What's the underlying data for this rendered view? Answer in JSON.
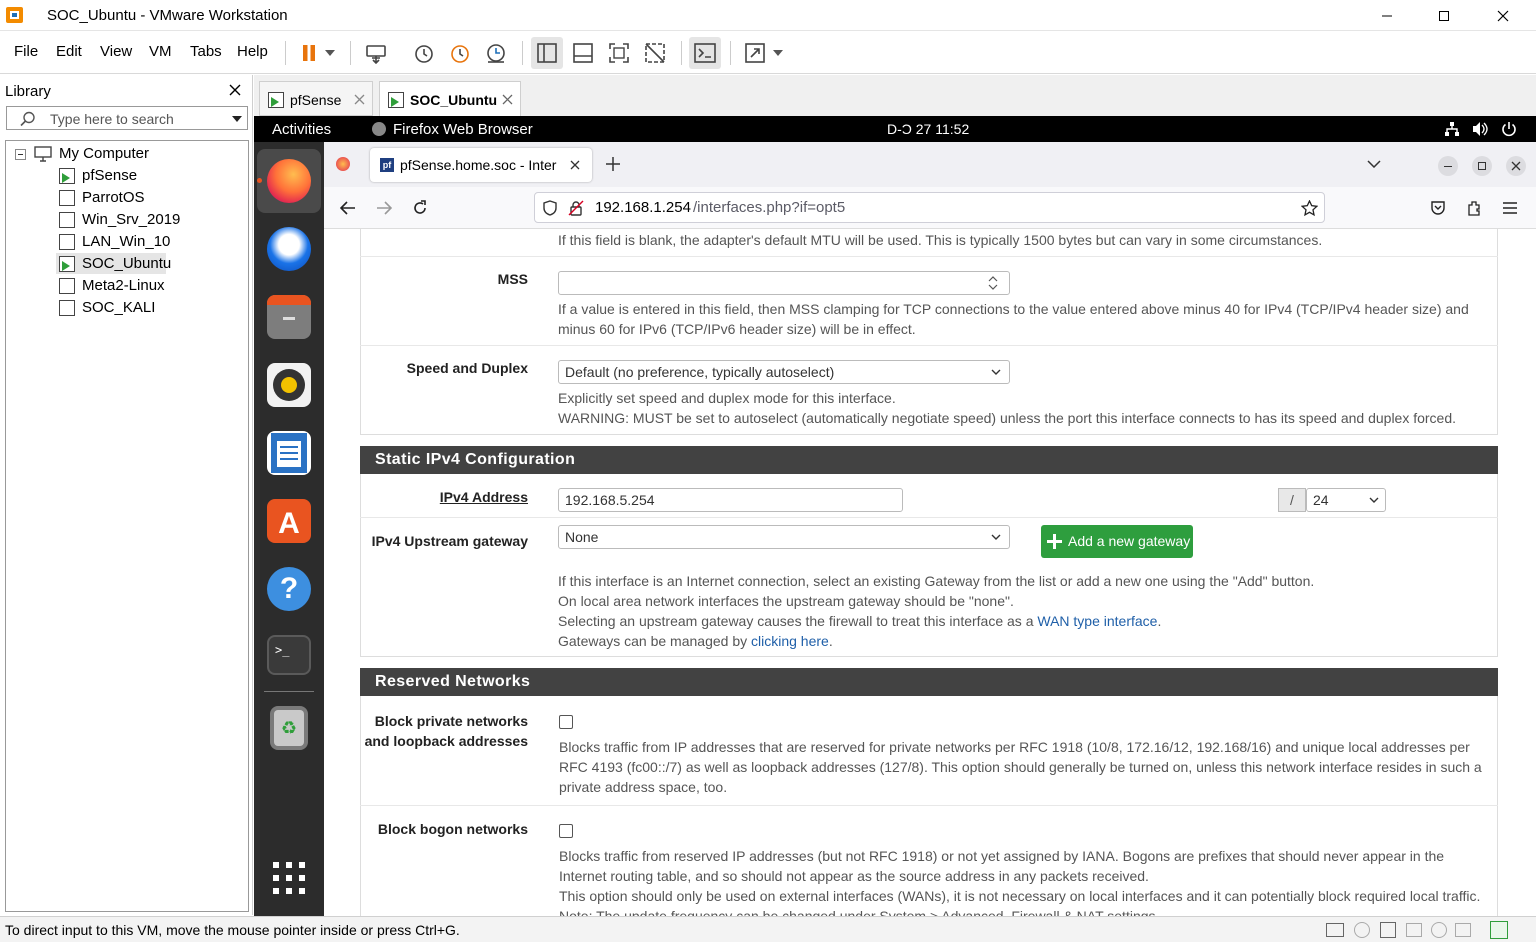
{
  "window": {
    "title": "SOC_Ubuntu - VMware Workstation"
  },
  "menu": [
    "File",
    "Edit",
    "View",
    "VM",
    "Tabs",
    "Help"
  ],
  "library": {
    "title": "Library",
    "search_placeholder": "Type here to search",
    "root": "My Computer",
    "vms": [
      "pfSense",
      "ParrotOS",
      "Win_Srv_2019",
      "LAN_Win_10",
      "SOC_Ubuntu",
      "Meta2-Linux",
      "SOC_KALI"
    ]
  },
  "vm_tabs": [
    "pfSense",
    "SOC_Ubuntu"
  ],
  "gnome": {
    "activities": "Activities",
    "app": "Firefox Web Browser",
    "clock": "D-Ͻ 27  11:52"
  },
  "firefox": {
    "tab_title": "pfSense.home.soc - Inter",
    "url_host": "192.168.1.254",
    "url_path": "/interfaces.php?if=opt5"
  },
  "page": {
    "mtu_help": "If this field is blank, the adapter's default MTU will be used. This is typically 1500 bytes but can vary in some circumstances.",
    "mss_label": "MSS",
    "mss_help": "If a value is entered in this field, then MSS clamping for TCP connections to the value entered above minus 40 for IPv4 (TCP/IPv4 header size) and minus 60 for IPv6 (TCP/IPv6 header size) will be in effect.",
    "speed_label": "Speed and Duplex",
    "speed_value": "Default (no preference, typically autoselect)",
    "speed_help_1": "Explicitly set speed and duplex mode for this interface.",
    "speed_help_2": "WARNING: MUST be set to autoselect (automatically negotiate speed) unless the port this interface connects to has its speed and duplex forced.",
    "static_section": "Static IPv4 Configuration",
    "ipv4_label": "IPv4 Address",
    "ipv4_value": "192.168.5.254",
    "slash": "/",
    "cidr": "24",
    "gw_label": "IPv4 Upstream gateway",
    "gw_value": "None",
    "add_gw": "Add a new gateway",
    "gw_help_1": "If this interface is an Internet connection, select an existing Gateway from the list or add a new one using the \"Add\" button.",
    "gw_help_2": "On local area network interfaces the upstream gateway should be \"none\".",
    "gw_help_3a": "Selecting an upstream gateway causes the firewall to treat this interface as a ",
    "gw_help_3_link": "WAN type interface",
    "gw_help_3b": ".",
    "gw_help_4a": "Gateways can be managed by ",
    "gw_help_4_link": "clicking here",
    "gw_help_4b": ".",
    "reserved_section": "Reserved Networks",
    "block_private_label_1": "Block private networks",
    "block_private_label_2": "and loopback addresses",
    "block_private_help": "Blocks traffic from IP addresses that are reserved for private networks per RFC 1918 (10/8, 172.16/12, 192.168/16) and unique local addresses per RFC 4193 (fc00::/7) as well as loopback addresses (127/8). This option should generally be turned on, unless this network interface resides in such a private address space, too.",
    "block_bogon_label": "Block bogon networks",
    "block_bogon_help_1": "Blocks traffic from reserved IP addresses (but not RFC 1918) or not yet assigned by IANA. Bogons are prefixes that should never appear in the Internet routing table, and so should not appear as the source address in any packets received.",
    "block_bogon_help_2": "This option should only be used on external interfaces (WANs), it is not necessary on local interfaces and it can potentially block required local traffic.",
    "block_bogon_help_3": "Note: The update frequency can be changed under System > Advanced, Firewall & NAT settings."
  },
  "status": {
    "text": "To direct input to this VM, move the mouse pointer inside or press Ctrl+G."
  },
  "colors": {
    "section_bg": "#424242",
    "green_button": "#2e9e3e",
    "link": "#1f5fa8",
    "dock": "#2c2c2c"
  }
}
